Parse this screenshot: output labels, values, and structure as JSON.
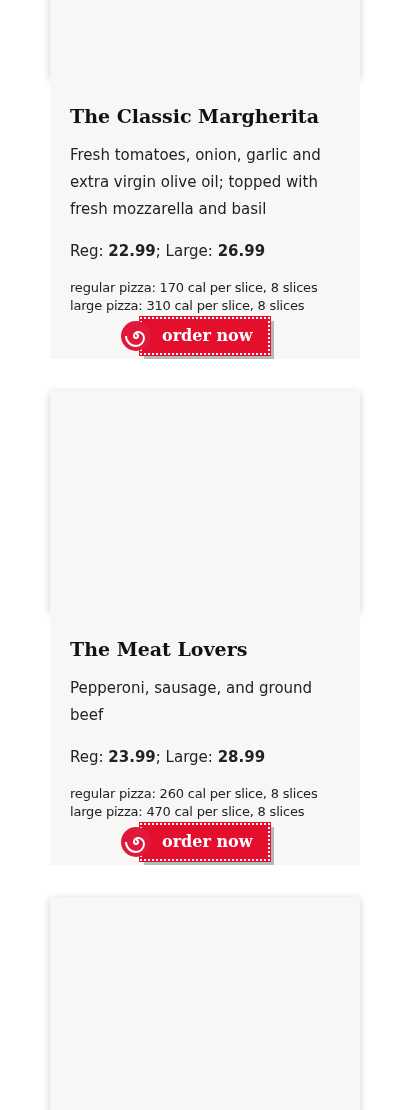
{
  "pizzas": [
    {
      "name": "The Classic Margherita",
      "description": "Fresh tomatoes, onion, garlic and extra virgin olive oil; topped with fresh mozzarella and basil",
      "prices": "Reg: **22.99**; Large: **26.99**",
      "calories": [
        "regular pizza: 170 cal per slice, 8 slices",
        "large pizza: 310 cal per slice, 8 slices"
      ],
      "button": "order now"
    },
    {
      "name": "The Meat Lovers",
      "description": "Pepperoni, sausage, and ground beef",
      "prices": "Reg: **23.99**; Large: **28.99**",
      "calories": [
        "regular pizza: 260 cal per slice, 8 slices",
        "large pizza: 470 cal per slice, 8 slices"
      ],
      "button": "order now"
    },
    {
      "kind": "image_only"
    }
  ]
}
